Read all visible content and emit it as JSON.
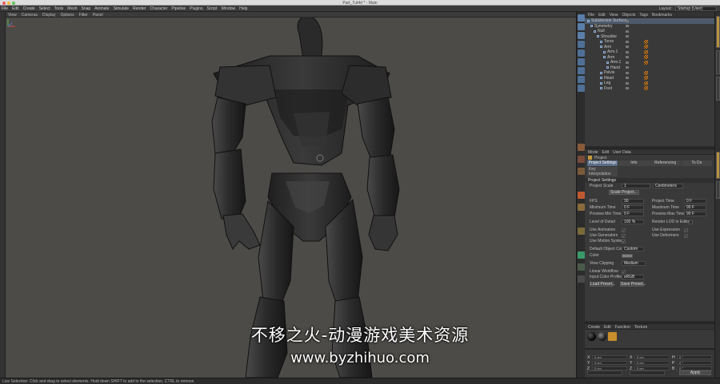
{
  "window": {
    "title": "Part_Tut4d * - Main"
  },
  "menubar": {
    "items": [
      "File",
      "Edit",
      "Create",
      "Select",
      "Tools",
      "Mesh",
      "Snap",
      "Animate",
      "Simulate",
      "Render",
      "Character",
      "Pipeline",
      "Plugins",
      "Script",
      "Window",
      "Help"
    ],
    "layout_label": "Layout:",
    "layout_value": "Startup (User)"
  },
  "viewport": {
    "menus": [
      "View",
      "Cameras",
      "Display",
      "Options",
      "Filter",
      "Panel"
    ]
  },
  "object_manager": {
    "menus": [
      "File",
      "Edit",
      "View",
      "Objects",
      "Tags",
      "Bookmarks"
    ],
    "objects": [
      {
        "label": "Subdivision Surface",
        "indent": 0,
        "selected": true,
        "tag": false
      },
      {
        "label": "Symmetry",
        "indent": 1,
        "selected": false,
        "tag": false
      },
      {
        "label": "Null",
        "indent": 2,
        "selected": false,
        "tag": false
      },
      {
        "label": "Shoulder",
        "indent": 3,
        "selected": false,
        "tag": false
      },
      {
        "label": "Torso",
        "indent": 4,
        "selected": false,
        "tag": true
      },
      {
        "label": "Arm",
        "indent": 4,
        "selected": false,
        "tag": true
      },
      {
        "label": "Arm.1",
        "indent": 5,
        "selected": false,
        "tag": true
      },
      {
        "label": "Arm",
        "indent": 5,
        "selected": false,
        "tag": true
      },
      {
        "label": "Arm.1",
        "indent": 6,
        "selected": false,
        "tag": true
      },
      {
        "label": "Hand",
        "indent": 6,
        "selected": false,
        "tag": false
      },
      {
        "label": "Pelvis",
        "indent": 4,
        "selected": false,
        "tag": true
      },
      {
        "label": "Head",
        "indent": 4,
        "selected": false,
        "tag": true
      },
      {
        "label": "Leg",
        "indent": 4,
        "selected": false,
        "tag": true
      },
      {
        "label": "Foot",
        "indent": 4,
        "selected": false,
        "tag": true
      }
    ]
  },
  "attribute_manager": {
    "menus": [
      "Mode",
      "Edit",
      "User Data"
    ],
    "title": "Project",
    "tabs": [
      "Project Settings",
      "Info",
      "Referencing",
      "To Do"
    ],
    "tab_extra": "Key Interpolation",
    "section": "Project Settings",
    "project_scale_label": "Project Scale",
    "project_scale_value": "1",
    "project_scale_unit": "Centimeters",
    "scale_button": "Scale Project...",
    "fps_label": "FPS",
    "fps_value": "30",
    "project_time_label": "Project Time",
    "project_time_value": "0 F",
    "min_time_label": "Minimum Time",
    "min_time_value": "0 F",
    "max_time_label": "Maximum Time",
    "max_time_value": "90 F",
    "preview_min_label": "Preview Min Time",
    "preview_min_value": "0 F",
    "preview_max_label": "Preview Max Time",
    "preview_max_value": "90 F",
    "lod_label": "Level of Detail",
    "lod_value": "100 %",
    "render_lod_label": "Render LOD in Editor",
    "use_animation_label": "Use Animation",
    "use_expression_label": "Use Expression",
    "use_generators_label": "Use Generators",
    "use_deformers_label": "Use Deformers",
    "use_motion_label": "Use Motion System",
    "default_color_label": "Default Object Color",
    "default_color_value": "Custom",
    "color_label": "Color",
    "view_clipping_label": "View Clipping",
    "view_clipping_value": "Medium",
    "linear_workflow_label": "Linear Workflow",
    "input_color_label": "Input Color Profile",
    "input_color_value": "sRGB",
    "load_preset": "Load Preset...",
    "save_preset": "Save Preset..."
  },
  "material_manager": {
    "menus": [
      "Create",
      "Edit",
      "Function",
      "Texture"
    ]
  },
  "coordinates": {
    "axes_left": [
      "X",
      "Y",
      "Z"
    ],
    "axes_mid": [
      "X",
      "Y",
      "Z"
    ],
    "axes_right": [
      "H",
      "P",
      "B"
    ],
    "values_left": [
      "0 cm",
      "0 cm",
      "0 cm"
    ],
    "values_mid": [
      "0 cm",
      "0 cm",
      "0 cm"
    ],
    "values_right": [
      "0 °",
      "0 °",
      "0 °"
    ],
    "apply_label": "Apply"
  },
  "status": {
    "text": "Live Selection: Click and drag to select elements. Hold down SHIFT to add to the selection, CTRL to remove."
  },
  "watermark": {
    "line1": "不移之火-动漫游戏美术资源",
    "line2": "www.byzhihuo.com"
  },
  "colors": {
    "accent_blue": "#5a6c86",
    "tag_orange": "#e08a2c",
    "viewport_bg": "#4c4b47"
  }
}
